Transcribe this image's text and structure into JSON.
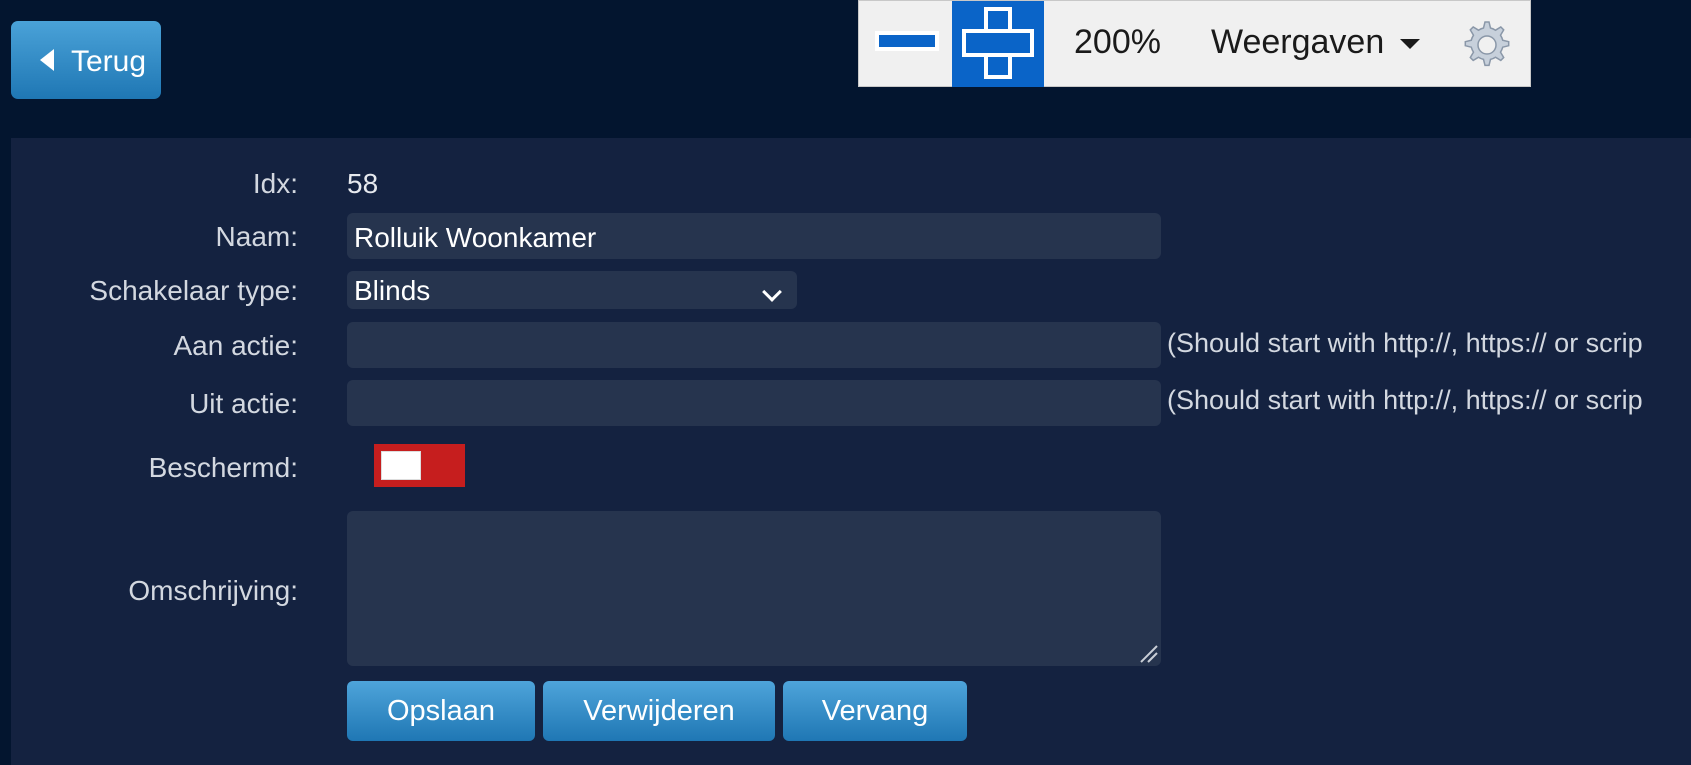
{
  "back_button": {
    "label": "Terug",
    "icon": "chevron-left-icon"
  },
  "zoom_toolbar": {
    "zoom_out_icon": "minus-icon",
    "zoom_in_icon": "plus-icon",
    "zoom_level": "200%",
    "views_label": "Weergaven",
    "settings_icon": "gear-icon",
    "active_color": "#0a64c8"
  },
  "form": {
    "idx": {
      "label": "Idx:",
      "value": "58"
    },
    "name": {
      "label": "Naam:",
      "value": "Rolluik Woonkamer"
    },
    "switch_type": {
      "label": "Schakelaar type:",
      "value": "Blinds"
    },
    "on_action": {
      "label": "Aan actie:",
      "value": "",
      "hint": "(Should start with http://, https:// or scrip"
    },
    "off_action": {
      "label": "Uit actie:",
      "value": "",
      "hint": "(Should start with http://, https:// or scrip"
    },
    "protected": {
      "label": "Beschermd:",
      "state": "off",
      "color": "#c61e1e"
    },
    "description": {
      "label": "Omschrijving:",
      "value": ""
    }
  },
  "buttons": {
    "save": "Opslaan",
    "delete": "Verwijderen",
    "replace": "Vervang"
  },
  "colors": {
    "background": "#03152f",
    "panel": "#142240",
    "field": "#26344e",
    "button": "#2b86c4"
  }
}
